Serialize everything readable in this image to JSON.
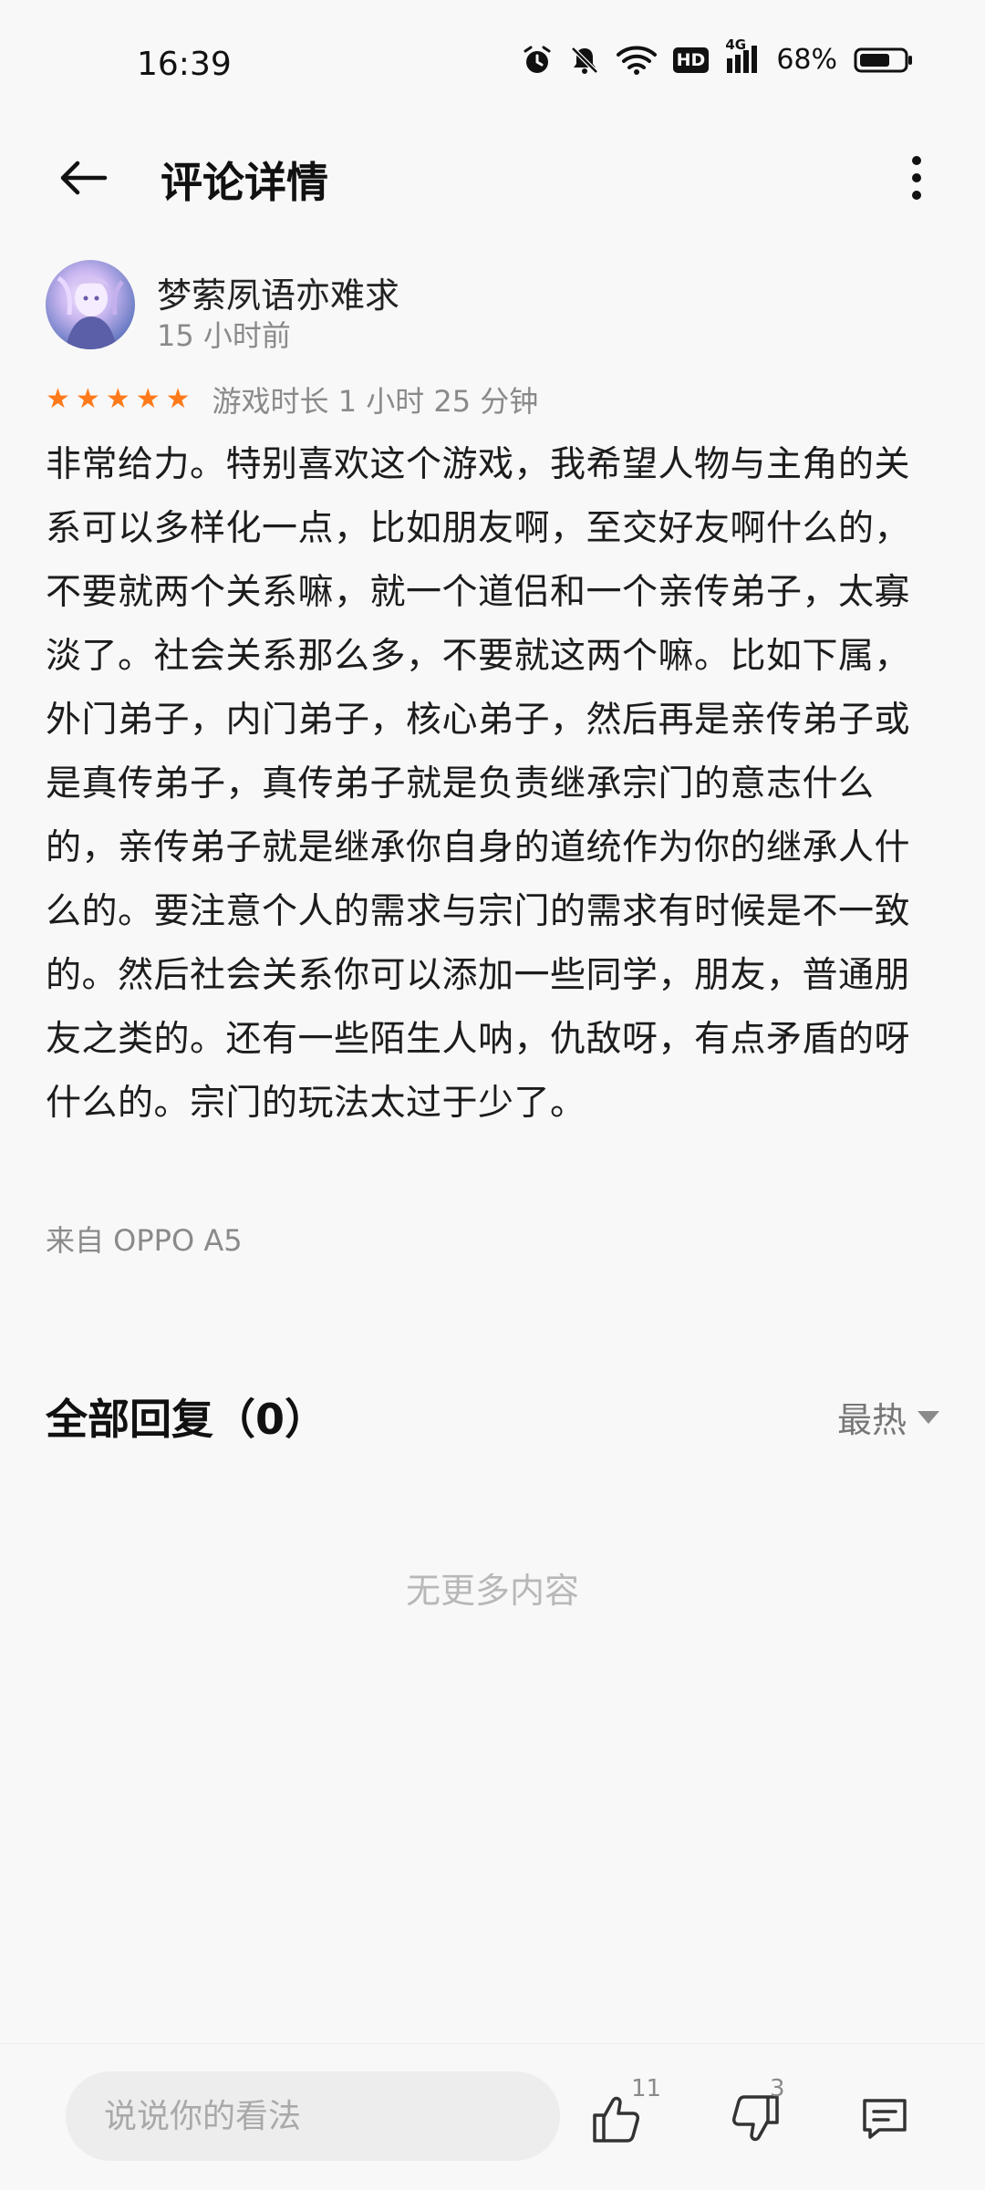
{
  "status_bar": {
    "time": "16:39",
    "network": "4G",
    "hd": "HD",
    "battery": "68%"
  },
  "header": {
    "title": "评论详情"
  },
  "comment": {
    "username": "梦萦夙语亦难求",
    "time_ago": "15 小时前",
    "rating": 5,
    "play_time": "游戏时长 1 小时 25 分钟",
    "text": "非常给力。特别喜欢这个游戏，我希望人物与主角的关系可以多样化一点，比如朋友啊，至交好友啊什么的，不要就两个关系嘛，就一个道侣和一个亲传弟子，太寡淡了。社会关系那么多，不要就这两个嘛。比如下属，外门弟子，内门弟子，核心弟子，然后再是亲传弟子或是真传弟子，真传弟子就是负责继承宗门的意志什么的，亲传弟子就是继承你自身的道统作为你的继承人什么的。要注意个人的需求与宗门的需求有时候是不一致的。然后社会关系你可以添加一些同学，朋友，普通朋友之类的。还有一些陌生人呐，仇敌呀，有点矛盾的呀什么的。宗门的玩法太过于少了。",
    "device": "来自 OPPO A5"
  },
  "replies": {
    "title": "全部回复（0）",
    "sort": "最热",
    "empty": "无更多内容"
  },
  "bottom_bar": {
    "input_placeholder": "说说你的看法",
    "like_count": "11",
    "dislike_count": "3"
  },
  "colors": {
    "star": "#ff7a1a",
    "background": "#f8f8f8",
    "muted_text": "#8a8a8a"
  }
}
